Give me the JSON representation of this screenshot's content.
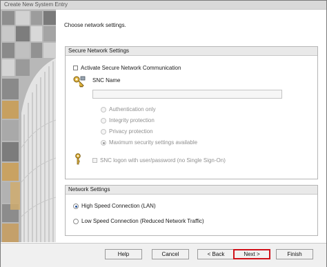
{
  "window": {
    "title": "Create New System Entry"
  },
  "prompt": "Choose network settings.",
  "secure_group": {
    "title": "Secure Network Settings",
    "activate_checkbox_label": "Activate Secure Network Communication",
    "snc_name_label": "SNC Name",
    "snc_name_value": "",
    "protection_options": [
      {
        "label": "Authentication only",
        "checked": false
      },
      {
        "label": "Integrity protection",
        "checked": false
      },
      {
        "label": "Privacy protection",
        "checked": false
      },
      {
        "label": "Maximum security settings available",
        "checked": true
      }
    ],
    "snc_logon_label": "SNC logon with user/password (no Single Sign-On)"
  },
  "network_group": {
    "title": "Network Settings",
    "options": [
      {
        "label": "High Speed Connection (LAN)",
        "checked": true
      },
      {
        "label": "Low Speed Connection (Reduced Network Traffic)",
        "checked": false
      }
    ]
  },
  "buttons": {
    "help": "Help",
    "cancel": "Cancel",
    "back": "< Back",
    "next": "Next >",
    "finish": "Finish"
  },
  "colors": {
    "accent_highlight": "#d01018",
    "group_header": "#e9e9e9"
  }
}
